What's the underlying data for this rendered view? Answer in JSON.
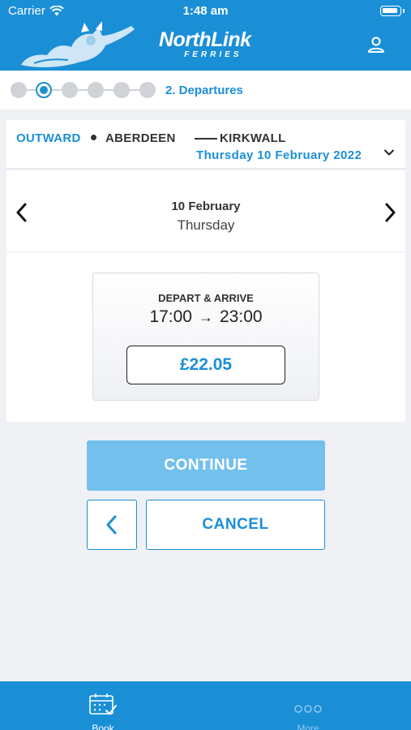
{
  "status_bar": {
    "carrier": "Carrier",
    "time": "1:48 am"
  },
  "header": {
    "brand_name": "NorthLink",
    "brand_sub": "FERRIES",
    "icons": [
      "viking-logo",
      "user-icon"
    ]
  },
  "progress": {
    "total_steps": 6,
    "current_step": 2,
    "label": "2. Departures"
  },
  "route": {
    "direction": "OUTWARD",
    "from": "ABERDEEN",
    "to": "KIRKWALL",
    "date": "Thursday 10 February 2022"
  },
  "day_nav": {
    "date": "10 February",
    "weekday": "Thursday"
  },
  "departure": {
    "title": "DEPART & ARRIVE",
    "depart": "17:00",
    "arrive": "23:00",
    "price": "£22.05"
  },
  "actions": {
    "continue_label": "CONTINUE",
    "cancel_label": "CANCEL"
  },
  "tab_bar": {
    "items": [
      {
        "label": "Book",
        "icon": "calendar-check-icon",
        "active": true
      },
      {
        "label": "More",
        "icon": "more-dots-icon",
        "active": false
      }
    ]
  },
  "colors": {
    "brand_blue": "#1b8fd6",
    "continue_disabled": "#73c0ec",
    "background": "#f0f1f5"
  }
}
